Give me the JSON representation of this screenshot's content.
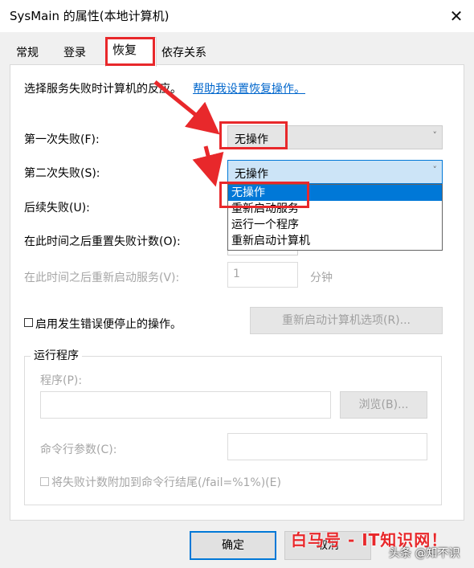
{
  "window": {
    "title": "SysMain 的属性(本地计算机)",
    "close_glyph": "✕"
  },
  "tabs": [
    {
      "label": "常规"
    },
    {
      "label": "登录"
    },
    {
      "label": "恢复",
      "active": true
    },
    {
      "label": "依存关系"
    }
  ],
  "intro": {
    "text": "选择服务失败时计算机的反应。",
    "help_link": "帮助我设置恢复操作。"
  },
  "first_failure": {
    "label": "第一次失败(F):",
    "value": "无操作"
  },
  "second_failure": {
    "label": "第二次失败(S):",
    "value": "无操作",
    "options": [
      "无操作",
      "重新启动服务",
      "运行一个程序",
      "重新启动计算机"
    ],
    "selected_index": 0
  },
  "subsequent_failure": {
    "label": "后续失败(U):"
  },
  "reset_count": {
    "label": "在此时间之后重置失败计数(O):"
  },
  "restart_service": {
    "label": "在此时间之后重新启动服务(V):",
    "value": "1",
    "unit": "分钟"
  },
  "stop_on_error": {
    "label": "启用发生错误便停止的操作。",
    "checked": false
  },
  "restart_options_button": "重新启动计算机选项(R)...",
  "run_program": {
    "group_title": "运行程序",
    "program_label": "程序(P):",
    "browse_button": "浏览(B)...",
    "args_label": "命令行参数(C):",
    "append_fail_label": "将失败计数附加到命令行结尾(/fail=%1%)(E)",
    "append_fail_checked": false
  },
  "buttons": {
    "ok": "确定",
    "cancel": "取消"
  },
  "watermark": {
    "text": "白马号 - IT知识网！",
    "author": "头条 @知不识"
  },
  "colors": {
    "accent": "#0078d7",
    "annotation_red": "#e8282b",
    "link": "#0066cc"
  },
  "icons": {
    "caret": "˅",
    "arrow": "red-arrow"
  }
}
